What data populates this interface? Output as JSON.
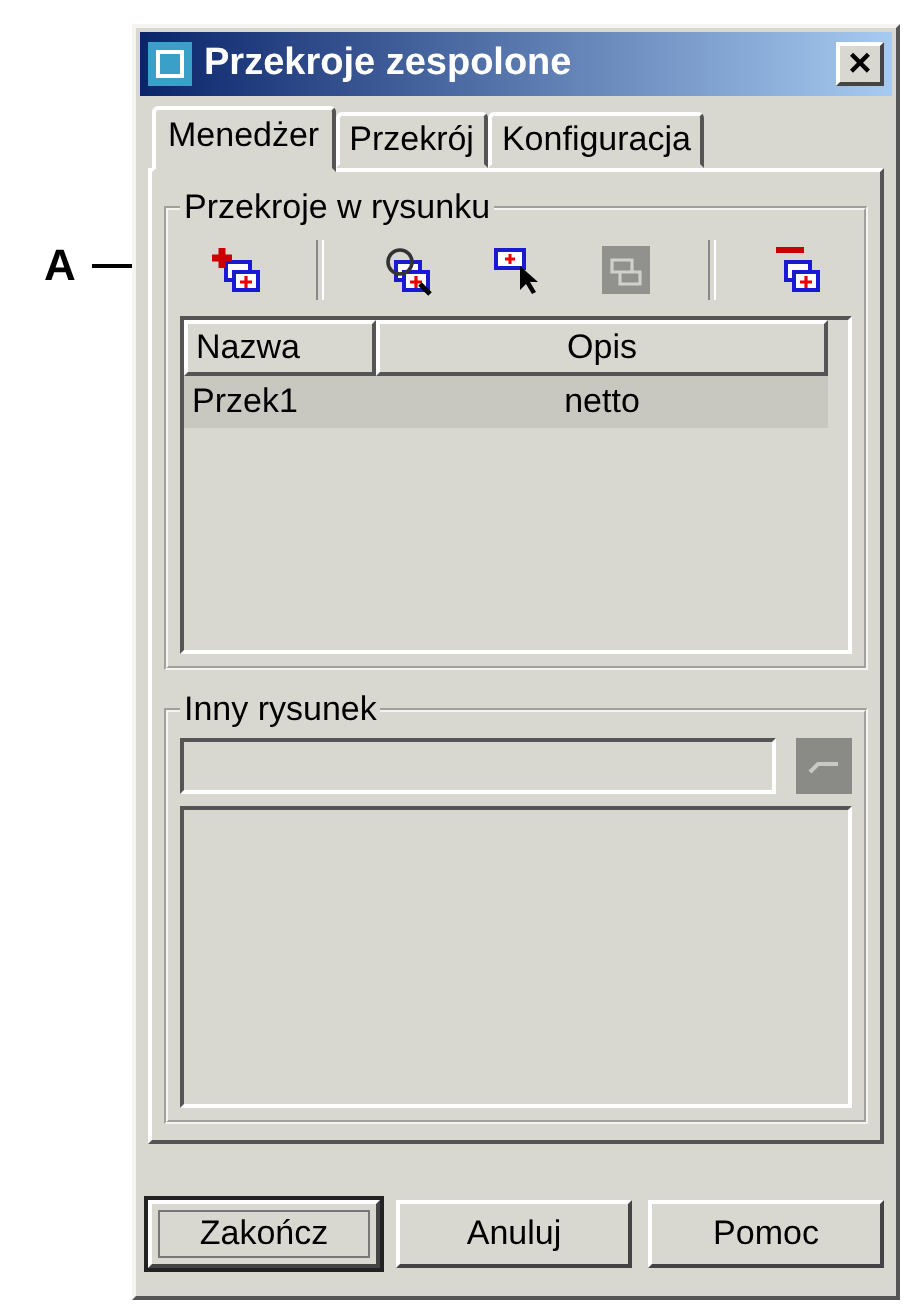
{
  "callout": {
    "label": "A"
  },
  "window": {
    "title": "Przekroje zespolone",
    "close": "×"
  },
  "tabs": [
    {
      "label": "Menedżer",
      "selected": true
    },
    {
      "label": "Przekrój",
      "selected": false
    },
    {
      "label": "Konfiguracja",
      "selected": false
    }
  ],
  "sections_group": {
    "title": "Przekroje w rysunku",
    "toolbar_groups": [
      [
        {
          "kind": "add",
          "disabled": false
        }
      ],
      [
        {
          "kind": "zoom",
          "disabled": false
        },
        {
          "kind": "pick",
          "disabled": false
        },
        {
          "kind": "copy",
          "disabled": true
        }
      ],
      [
        {
          "kind": "remove",
          "disabled": false
        }
      ]
    ],
    "table": {
      "columns": [
        "Nazwa",
        "Opis"
      ],
      "rows": [
        {
          "cells": [
            "Przek1",
            "netto"
          ],
          "selected": true
        }
      ]
    }
  },
  "other_drawing": {
    "title": "Inny rysunek",
    "browse_disabled": true
  },
  "buttons": [
    {
      "label": "Zakończ",
      "default": true
    },
    {
      "label": "Anuluj",
      "default": false
    },
    {
      "label": "Pomoc",
      "default": false
    }
  ]
}
